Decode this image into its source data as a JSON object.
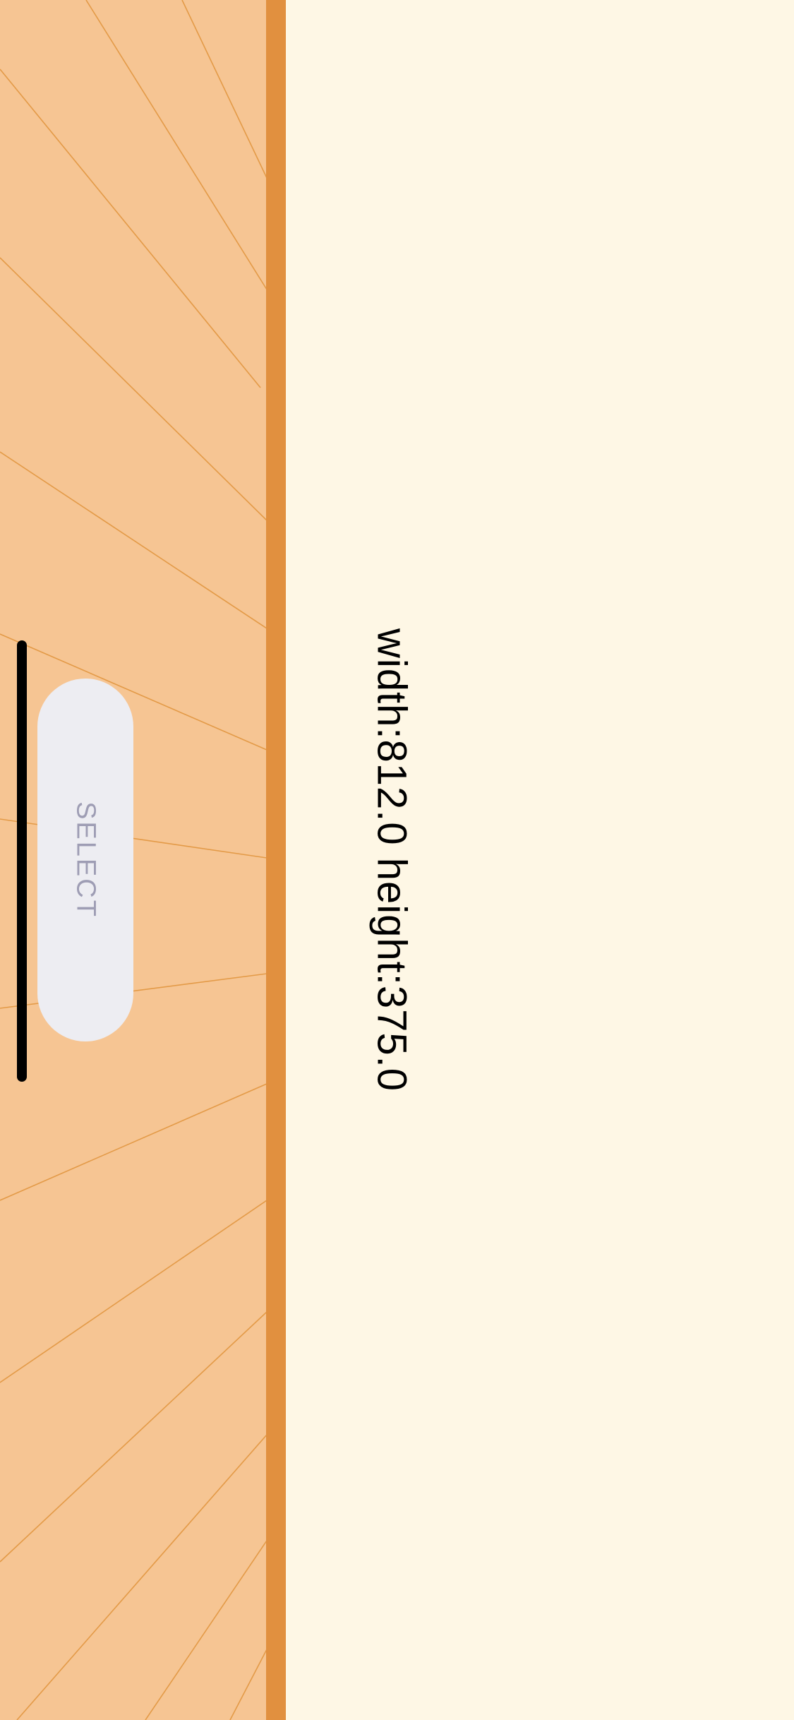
{
  "panel": {
    "background_color": "#f6c593",
    "edge_color": "#e1903f",
    "ray_color": "#e39a47"
  },
  "page": {
    "background_color": "#fef7e5"
  },
  "info": {
    "text": "width:812.0 height:375.0"
  },
  "select_button": {
    "label": "SELECT"
  }
}
